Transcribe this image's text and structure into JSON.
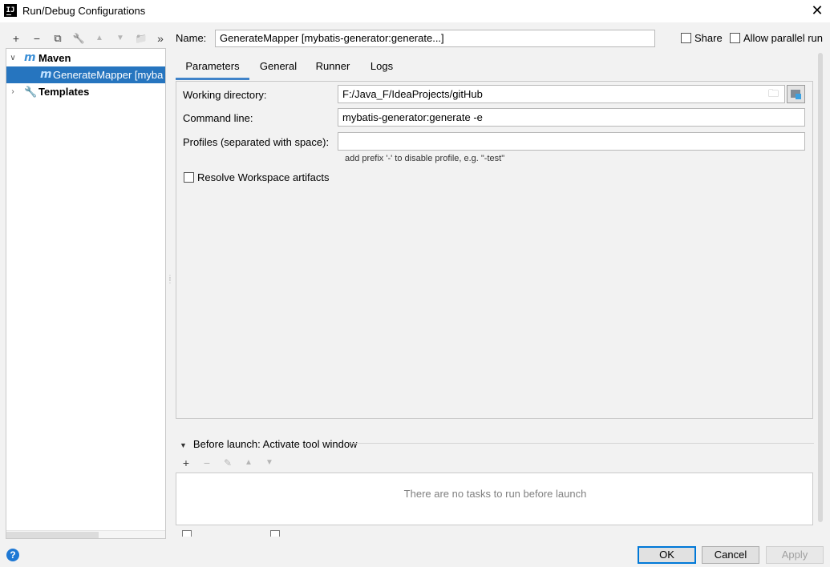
{
  "window": {
    "title": "Run/Debug Configurations",
    "icon_text": "IJ",
    "close_glyph": "✕"
  },
  "left_toolbar": {
    "add": "+",
    "remove": "−",
    "copy": "⧉",
    "edit": "🔧",
    "up": "▲",
    "down": "▼",
    "folder": "📁",
    "more": "»"
  },
  "tree": {
    "items": [
      {
        "label": "Maven",
        "icon": "m",
        "expanded": true
      },
      {
        "label": "GenerateMapper [myba",
        "icon": "m",
        "selected": true
      },
      {
        "label": "Templates",
        "expanded": false
      }
    ]
  },
  "config": {
    "name_label": "Name:",
    "name_value": "GenerateMapper [mybatis-generator:generate...]",
    "share_label": "Share",
    "allow_parallel_label": "Allow parallel run"
  },
  "tabs": [
    {
      "label": "Parameters",
      "active": true
    },
    {
      "label": "General"
    },
    {
      "label": "Runner"
    },
    {
      "label": "Logs"
    }
  ],
  "parameters": {
    "working_dir_label": "Working directory:",
    "working_dir_value": "F:/Java_F/IdeaProjects/gitHub",
    "command_line_label": "Command line:",
    "command_line_value": "mybatis-generator:generate -e",
    "profiles_label": "Profiles (separated with space):",
    "profiles_value": "",
    "profiles_hint": "add prefix '-' to disable profile, e.g. \"-test\"",
    "resolve_label": "Resolve Workspace artifacts"
  },
  "before_launch": {
    "header": "Before launch: Activate tool window",
    "empty_text": "There are no tasks to run before launch"
  },
  "buttons": {
    "ok": "OK",
    "cancel": "Cancel",
    "apply": "Apply",
    "help": "?"
  },
  "colors": {
    "selection": "#2675bf",
    "accent": "#4083c9",
    "maven_icon": "#3c8fd6"
  }
}
